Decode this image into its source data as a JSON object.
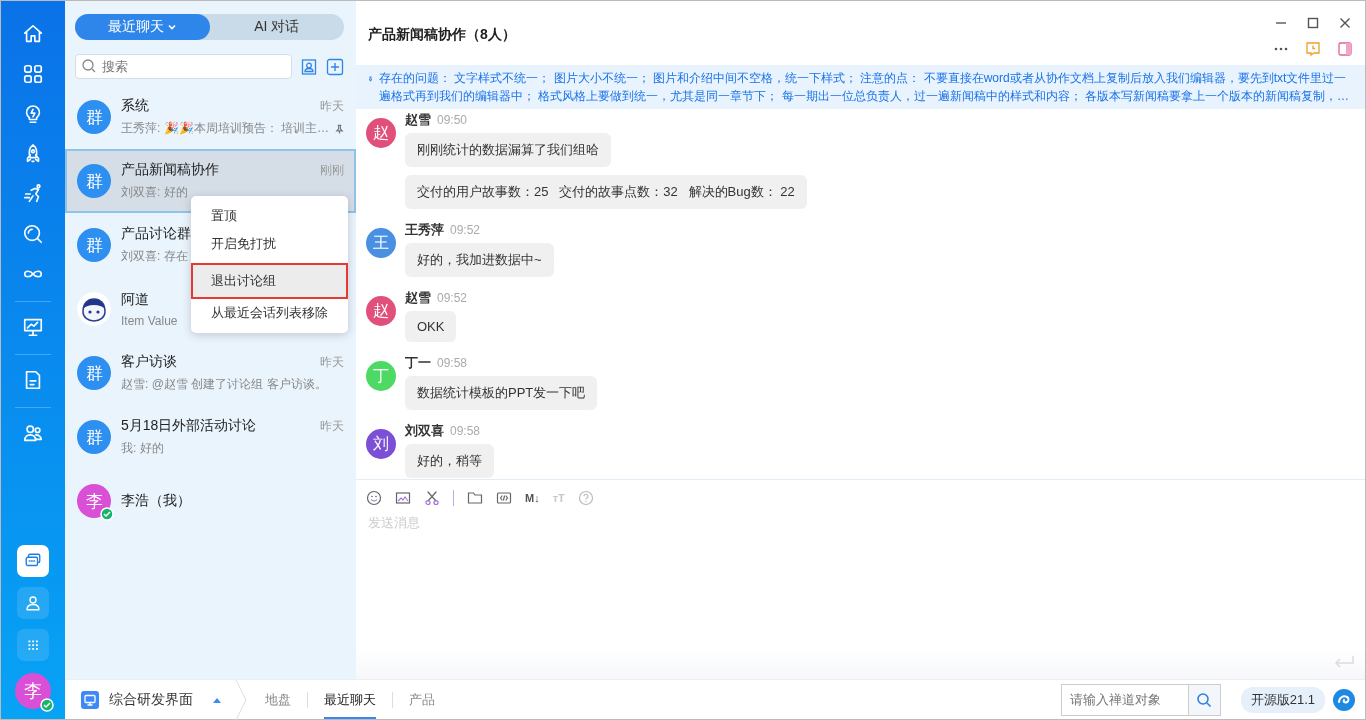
{
  "rail": {
    "bottom_items": [
      {
        "selected": true
      },
      {
        "selected": false
      },
      {
        "selected": false
      }
    ],
    "avatar": {
      "text": "李",
      "online": true
    }
  },
  "list_tabs": [
    {
      "label": "最近聊天",
      "selected": true,
      "dropdown": true
    },
    {
      "label": "AI 对话",
      "selected": false,
      "dropdown": false
    }
  ],
  "search": {
    "placeholder": "搜索"
  },
  "chats": [
    {
      "kind": "group",
      "avatar_text": "群",
      "name": "系统",
      "time": "昨天",
      "preview": "王秀萍: 🎉🎉本周培训预告： 培训主…",
      "pinned": true,
      "selected": false
    },
    {
      "kind": "group",
      "avatar_text": "群",
      "name": "产品新闻稿协作",
      "time": "刚刚",
      "preview": "刘双喜: 好的",
      "pinned": false,
      "selected": true
    },
    {
      "kind": "group",
      "avatar_text": "群",
      "name": "产品讨论群",
      "preview": "刘双喜: 存在",
      "pinned": false,
      "selected": false
    },
    {
      "kind": "bot",
      "name": "阿道",
      "preview": "Item Value",
      "pinned": false,
      "selected": false
    },
    {
      "kind": "group",
      "avatar_text": "群",
      "name": "客户访谈",
      "time": "昨天",
      "preview": "赵雪: @赵雪 创建了讨论组 客户访谈。",
      "pinned": false,
      "selected": false
    },
    {
      "kind": "group",
      "avatar_text": "群",
      "name": "5月18日外部活动讨论",
      "time": "昨天",
      "preview": "我: 好的",
      "pinned": false,
      "selected": false
    },
    {
      "kind": "person",
      "avatar_text": "李",
      "color": "#d94fd6",
      "online": true,
      "name": "李浩（我）",
      "pinned": false,
      "selected": false
    }
  ],
  "context_menu": [
    {
      "label": "置顶",
      "selected": false
    },
    {
      "label": "开启免打扰",
      "selected": false
    },
    {
      "label": "退出讨论组",
      "selected": true
    },
    {
      "label": "从最近会话列表移除",
      "selected": false
    }
  ],
  "chat": {
    "title": "产品新闻稿协作（8人）",
    "notice": "存在的问题： 文字样式不统一； 图片大小不统一； 图片和介绍中间不空格，统一下样式； 注意的点： 不要直接在word或者从协作文档上复制后放入我们编辑器，要先到txt文件里过一遍格式再到我们的编辑器中； 格式风格上要做到统一，尤其是同一章节下； 每一期出一位总负责人，过一遍新闻稿中的样式和内容； 各版本写新闻稿要拿上一个版本的新闻稿复制，…",
    "messages": [
      {
        "sender": "赵雪",
        "time": "09:50",
        "avatar_text": "赵",
        "color": "#e0507a",
        "bubbles": [
          "刚刚统计的数据漏算了我们组哈",
          "交付的用户故事数：25   交付的故事点数：32   解决的Bug数： 22"
        ]
      },
      {
        "sender": "王秀萍",
        "time": "09:52",
        "avatar_text": "王",
        "color": "#4a90e2",
        "bubbles": [
          "好的，我加进数据中~"
        ]
      },
      {
        "sender": "赵雪",
        "time": "09:52",
        "avatar_text": "赵",
        "color": "#e0507a",
        "bubbles": [
          "OKK"
        ]
      },
      {
        "sender": "丁一",
        "time": "09:58",
        "avatar_text": "丁",
        "color": "#4cd964",
        "bubbles": [
          "数据统计模板的PPT发一下吧"
        ]
      },
      {
        "sender": "刘双喜",
        "time": "09:58",
        "avatar_text": "刘",
        "color": "#7b4fd6",
        "bubbles": [
          "好的，稍等"
        ]
      }
    ],
    "toolbar_glyphs": [
      {
        "text": "M↓",
        "disabled": false
      },
      {
        "text": "тT",
        "disabled": true
      }
    ],
    "placeholder": "发送消息"
  },
  "bottom_bar": {
    "app": "综合研发界面",
    "tabs": [
      {
        "label": "地盘",
        "selected": false
      },
      {
        "label": "最近聊天",
        "selected": true
      },
      {
        "label": "产品",
        "selected": false
      }
    ],
    "search_placeholder": "请输入禅道对象",
    "version": "开源版21.1"
  }
}
